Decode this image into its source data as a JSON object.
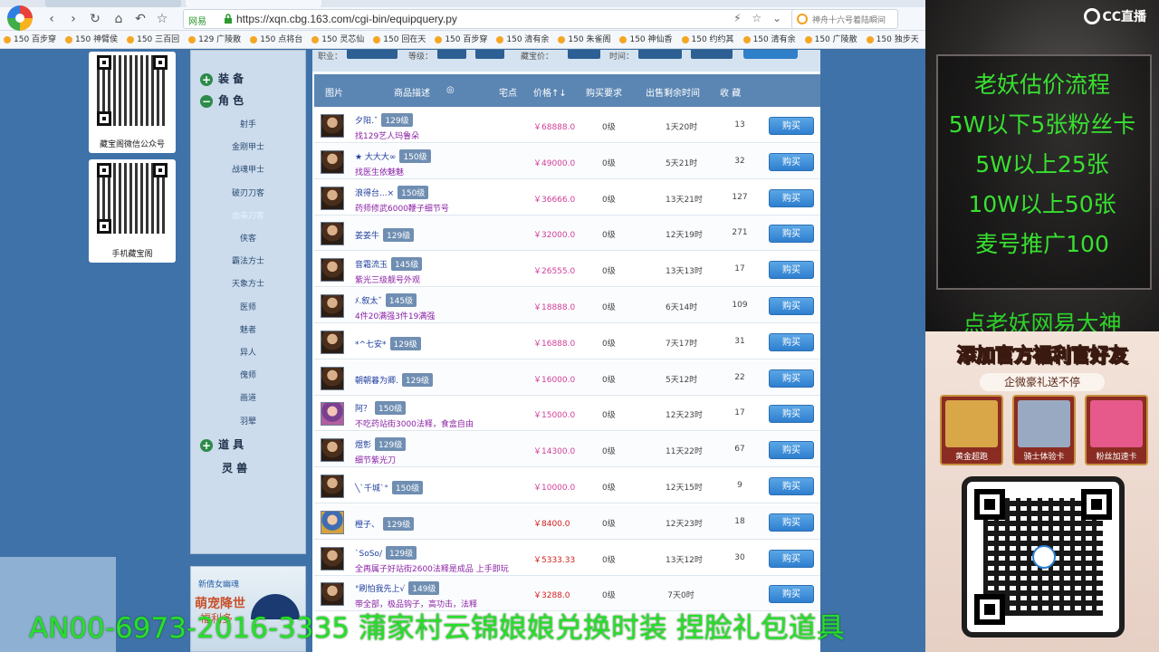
{
  "browser": {
    "address": {
      "site_tag": "网易",
      "url": "https://xqn.cbg.163.com/cgi-bin/equipquery.py",
      "tools": "⚡ ☆ ⌄"
    },
    "search_placeholder": "神舟十六号着陆瞬间",
    "bookmarks": [
      "150 百步穿",
      "150 神臂侯",
      "150 三百回",
      "129 广陵散",
      "150 点将台",
      "150 灵芯仙",
      "150 回在天",
      "150 百步穿",
      "150 清有余",
      "150 朱雀阁",
      "150 神仙香",
      "150 约约其",
      "150 清有余",
      "150 广陵散",
      "150 独步天"
    ]
  },
  "qr_cards": [
    {
      "caption": "藏宝阁微信公众号"
    },
    {
      "caption": "手机藏宝阁"
    }
  ],
  "sidebar": {
    "categories": [
      {
        "label": "装 备",
        "icon": "plus-icon"
      },
      {
        "label": "角 色",
        "icon": "minus-icon"
      },
      {
        "label": "道 具",
        "icon": "plus-icon"
      },
      {
        "label": "灵 兽",
        "icon": ""
      }
    ],
    "items": [
      "射手",
      "金刚甲士",
      "战魂甲士",
      "破刃刀客",
      "血枭刀客",
      "侠客",
      "霸法方士",
      "天象方士",
      "医师",
      "魅者",
      "异人",
      "傀师",
      "画道",
      "羽翚"
    ],
    "active_index": 4
  },
  "promo": {
    "t1": "新倩女幽魂",
    "t2": "萌宠降世",
    "t3": "福利多"
  },
  "table": {
    "headers": {
      "pic": "图片",
      "desc": "商品描述",
      "server": "宅点",
      "price": "价格↑↓",
      "req": "购买要求",
      "remain": "出售剩余时间",
      "fav": "收 藏"
    },
    "buy_label": "购买",
    "rows": [
      {
        "name": "夕阳.ˇ",
        "level": "129级",
        "desc": "找129艺人玛鲁朵",
        "price": "￥68888.0",
        "req": "0级",
        "remain": "1天20时",
        "fav": "13",
        "avatar": "dark"
      },
      {
        "name": "★ 大大大∞",
        "level": "150级",
        "desc": "找医生依魅魅",
        "price": "￥49000.0",
        "req": "0级",
        "remain": "5天21时",
        "fav": "32",
        "avatar": "dark"
      },
      {
        "name": "浪得台...×",
        "level": "150级",
        "desc": "药师修武6000鞭子细节号",
        "price": "￥36666.0",
        "req": "0级",
        "remain": "13天21时",
        "fav": "127",
        "avatar": "dark"
      },
      {
        "name": "姜姜牛",
        "level": "129级",
        "desc": "",
        "price": "￥32000.0",
        "req": "0级",
        "remain": "12天19时",
        "fav": "271",
        "avatar": "dark"
      },
      {
        "name": "音霜流玉",
        "level": "145级",
        "desc": "紫光三级靓号外观",
        "price": "￥26555.0",
        "req": "0级",
        "remain": "13天13时",
        "fav": "17",
        "avatar": "dark"
      },
      {
        "name": "ﾒ.叙太ˇ",
        "level": "145级",
        "desc": "4件20满强3件19满强",
        "price": "￥18888.0",
        "req": "0级",
        "remain": "6天14时",
        "fav": "109",
        "avatar": "dark"
      },
      {
        "name": "*^七安*",
        "level": "129级",
        "desc": "",
        "price": "￥16888.0",
        "req": "0级",
        "remain": "7天17时",
        "fav": "31",
        "avatar": "dark"
      },
      {
        "name": "朝朝暮为卿.",
        "level": "129级",
        "desc": "",
        "price": "￥16000.0",
        "req": "0级",
        "remain": "5天12时",
        "fav": "22",
        "avatar": "dark"
      },
      {
        "name": "阿？",
        "level": "150级",
        "desc": "不吃药站街3000法释，食盒自由",
        "price": "￥15000.0",
        "req": "0级",
        "remain": "12天23时",
        "fav": "17",
        "avatar": "girl"
      },
      {
        "name": "煜彰",
        "level": "129级",
        "desc": "细节紫光刀",
        "price": "￥14300.0",
        "req": "0级",
        "remain": "11天22时",
        "fav": "67",
        "avatar": "dark"
      },
      {
        "name": "╲ˋ千城ˋ°",
        "level": "150级",
        "desc": "",
        "price": "￥10000.0",
        "req": "0级",
        "remain": "12天15时",
        "fav": "9",
        "avatar": "dark"
      },
      {
        "name": "橙子、",
        "level": "129级",
        "desc": "",
        "price": "￥8400.0",
        "req": "0级",
        "remain": "12天23时",
        "fav": "18",
        "avatar": "boy"
      },
      {
        "name": "ˋSoSo∕",
        "level": "129级",
        "desc": "全再属子好站街2600法释是成品 上手即玩",
        "price": "￥5333.33",
        "req": "0级",
        "remain": "13天12时",
        "fav": "30",
        "avatar": "dark"
      },
      {
        "name": "°刷怕我先上√",
        "level": "149级",
        "desc": "带全部，极品钩子，高功击，法释",
        "price": "￥3288.0",
        "req": "0级",
        "remain": "7天0时",
        "fav": "",
        "avatar": "dark"
      }
    ]
  },
  "overlay": {
    "cc_logo": "CC直播",
    "flow": [
      "老妖估价流程",
      "5W以下5张粉丝卡",
      "5W以上25张",
      "10W以上50张",
      "麦号推广100",
      "点老妖网易大神"
    ],
    "wish_title": "添加官方福利官好友",
    "wish_sub": "企微豪礼送不停",
    "gifts": [
      {
        "label": "黄金超跑",
        "color": "#d9a648"
      },
      {
        "label": "骑士体验卡",
        "color": "#9aa9c2"
      },
      {
        "label": "粉丝加速卡",
        "color": "#e55a8a"
      }
    ],
    "ticker": "AN00-6973-2016-3335 蒲家村云锦娘娘兑换时装 捏脸礼包道具"
  }
}
